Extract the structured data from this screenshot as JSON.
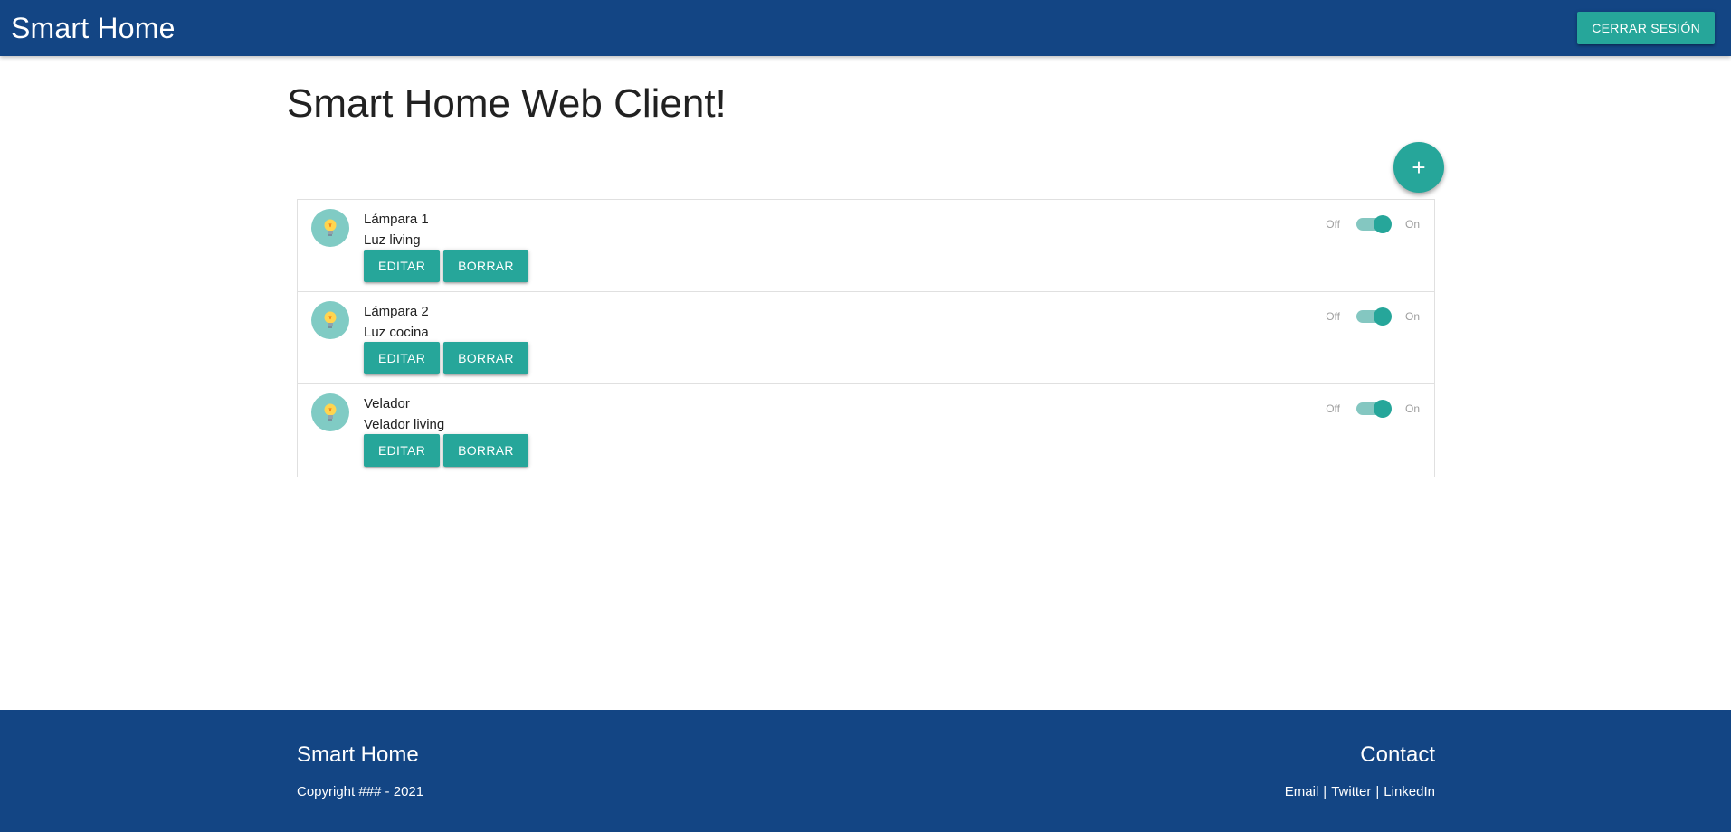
{
  "navbar": {
    "brand": "Smart Home",
    "logout_label": "CERRAR SESIÓN"
  },
  "main": {
    "title": "Smart Home Web Client!",
    "add_button_icon": "+"
  },
  "devices": [
    {
      "name": "Lámpara 1",
      "description": "Luz living",
      "icon": "lightbulb-icon",
      "edit_label": "EDITAR",
      "delete_label": "BORRAR",
      "switch_off_label": "Off",
      "switch_on_label": "On",
      "state": "on"
    },
    {
      "name": "Lámpara 2",
      "description": "Luz cocina",
      "icon": "lightbulb-icon",
      "edit_label": "EDITAR",
      "delete_label": "BORRAR",
      "switch_off_label": "Off",
      "switch_on_label": "On",
      "state": "on"
    },
    {
      "name": "Velador",
      "description": "Velador living",
      "icon": "lightbulb-icon",
      "edit_label": "EDITAR",
      "delete_label": "BORRAR",
      "switch_off_label": "Off",
      "switch_on_label": "On",
      "state": "on"
    }
  ],
  "footer": {
    "left_title": "Smart Home",
    "copyright": "Copyright ### - 2021",
    "right_title": "Contact",
    "links": {
      "email": "Email",
      "sep1": "|",
      "twitter": "Twitter",
      "sep2": "|",
      "linkedin": "LinkedIn"
    }
  },
  "colors": {
    "primary": "#134584",
    "accent": "#26a69a",
    "avatar_bg": "#80cbc4",
    "bulb": "#ffd54f"
  }
}
